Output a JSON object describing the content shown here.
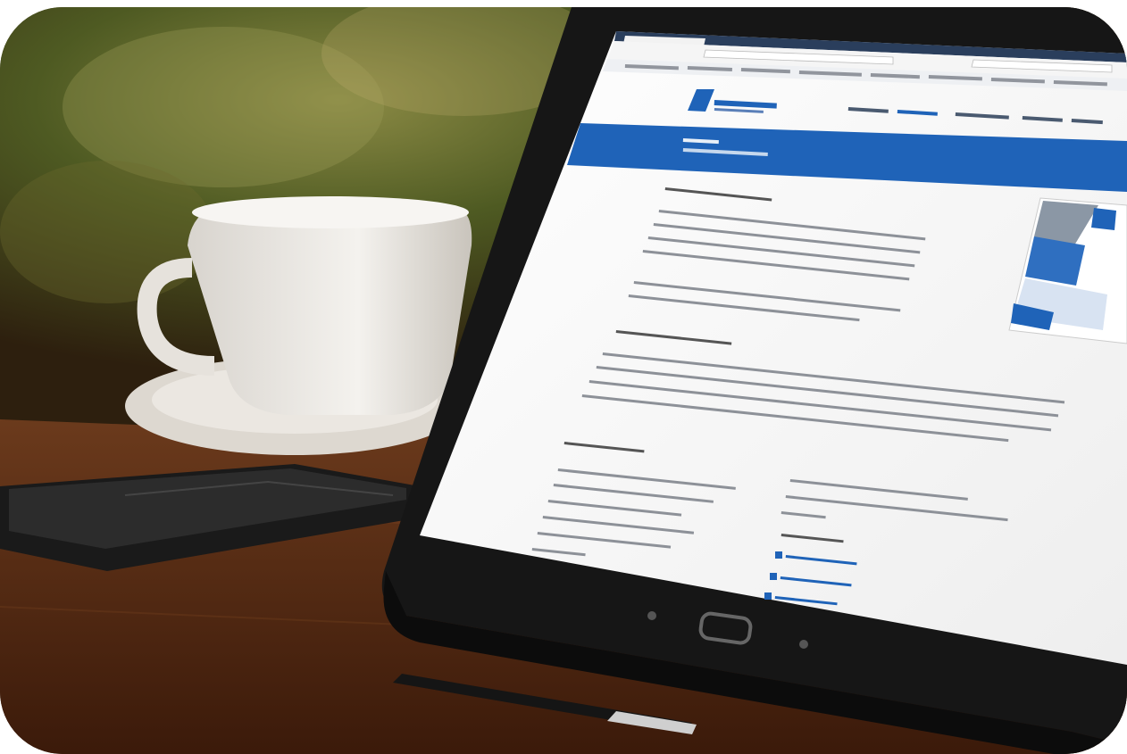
{
  "scene": {
    "description_colors": {
      "accent_blue": "#1f63b8",
      "desk_wood": "#5a2e16",
      "tablet_frame": "#1c1c1c"
    }
  },
  "browser": {
    "tab_title": "",
    "address": "",
    "bookmarks": []
  },
  "site": {
    "logo_text": "",
    "nav": [
      "",
      "",
      "",
      "",
      ""
    ],
    "banner_title": "",
    "banner_subtitle": "",
    "section_heading_1": "",
    "section_heading_2": "",
    "section_heading_3": "",
    "contact_heading": "",
    "contact_lines": [
      "",
      "",
      ""
    ]
  },
  "icons": [
    "coffee-cup-icon",
    "smartphone-icon",
    "tablet-icon",
    "stylus-icon",
    "home-button-icon",
    "back-button-icon"
  ]
}
